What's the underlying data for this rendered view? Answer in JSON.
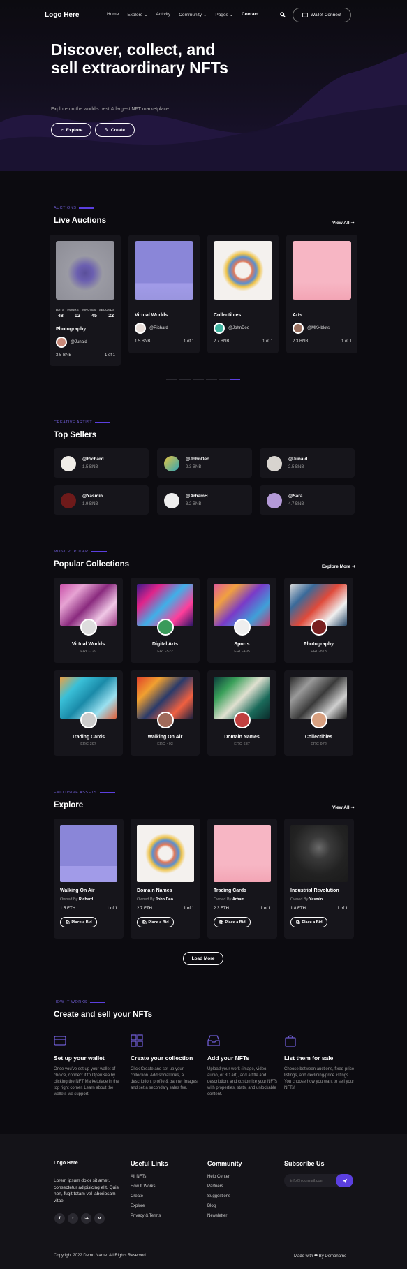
{
  "nav": {
    "logo": "Logo Here",
    "links": [
      "Home",
      "Explore ⌄",
      "Activity",
      "Community ⌄",
      "Pages ⌄",
      "Contact"
    ],
    "search_icon": "search-icon",
    "wallet_label": "Wallet Connect"
  },
  "hero": {
    "title": "Discover, collect, and sell extraordinary NFTs",
    "subtitle": "Explore on the world's best & largest NFT marketplace",
    "explore_label": "Explore",
    "create_label": "Create"
  },
  "auctions": {
    "tag": "AUCTIONS",
    "title": "Live Auctions",
    "view_all": "View All",
    "countdown_labels": [
      "DAYS",
      "HOURS",
      "MINUTES",
      "SECONDS"
    ],
    "countdown_values": [
      "48",
      "02",
      "45",
      "22"
    ],
    "items": [
      {
        "title": "Photography",
        "owner": "@Junaid",
        "price": "3.5 BNB",
        "qty": "1 of 1",
        "color": "#8d8d96"
      },
      {
        "title": "Virtual Worlds",
        "owner": "@Richard",
        "price": "1.5 BNB",
        "qty": "1 of 1",
        "color": "#8a86d8"
      },
      {
        "title": "Collectibles",
        "owner": "@JohnDeo",
        "price": "2.7 BNB",
        "qty": "1 of 1",
        "color": "#f4f1ee"
      },
      {
        "title": "Arts",
        "owner": "@MKHblots",
        "price": "2.3 BNB",
        "qty": "1 of 1",
        "color": "#f7b6c4"
      }
    ]
  },
  "sellers": {
    "tag": "CREATIVE ARTIST",
    "title": "Top Sellers",
    "items": [
      {
        "name": "@Richard",
        "amount": "1.5 BNB"
      },
      {
        "name": "@JohnDeo",
        "amount": "2.3 BNB"
      },
      {
        "name": "@Junaid",
        "amount": "2.5 BNB"
      },
      {
        "name": "@Yasmin",
        "amount": "1.9 BNB"
      },
      {
        "name": "@ArhamH",
        "amount": "3.2 BNB"
      },
      {
        "name": "@Sara",
        "amount": "4.7 BNB"
      }
    ]
  },
  "collections": {
    "tag": "MOST POPULAR",
    "title": "Popular Collections",
    "explore_more": "Explore More",
    "items": [
      {
        "title": "Virtual Worlds",
        "erc": "ERC-729"
      },
      {
        "title": "Digital Arts",
        "erc": "ERC-522"
      },
      {
        "title": "Sports",
        "erc": "ERC-495"
      },
      {
        "title": "Photography",
        "erc": "ERC-873"
      },
      {
        "title": "Trading Cards",
        "erc": "ERC-397"
      },
      {
        "title": "Walking On Air",
        "erc": "ERC-403"
      },
      {
        "title": "Domain Names",
        "erc": "ERC-687"
      },
      {
        "title": "Collectibles",
        "erc": "ERC-972"
      }
    ]
  },
  "explore": {
    "tag": "EXCLUSIVE ASSETS",
    "title": "Explore",
    "view_all": "View All",
    "owned_by": "Owned By",
    "bid_label": "Place a Bid",
    "load_more": "Load More",
    "items": [
      {
        "title": "Walking On Air",
        "owner": "Richard",
        "price": "1.5 ETH",
        "qty": "1 of 1"
      },
      {
        "title": "Domain Names",
        "owner": "John Deo",
        "price": "2.7 ETH",
        "qty": "1 of 1"
      },
      {
        "title": "Trading Cards",
        "owner": "Arham",
        "price": "2.3 ETH",
        "qty": "1 of 1"
      },
      {
        "title": "Industrial Revolution",
        "owner": "Yasmin",
        "price": "1.8 ETH",
        "qty": "1 of 1"
      }
    ]
  },
  "how": {
    "tag": "HOW IT WORKS",
    "title": "Create and sell your NFTs",
    "steps": [
      {
        "title": "Set up your wallet",
        "desc": "Once you've set up your wallet of choice, connect it to OpenSea by clicking the NFT Marketplace in the top right corner. Learn about the wallets we support.",
        "icon": "wallet-icon"
      },
      {
        "title": "Create your collection",
        "desc": "Click Create and set up your collection. Add social links, a description, profile & banner images, and set a secondary sales fee.",
        "icon": "grid-icon"
      },
      {
        "title": "Add your NFTs",
        "desc": "Upload your work (image, video, audio, or 3D art), add a title and description, and customize your NFTs with properties, stats, and unlockable content.",
        "icon": "inbox-icon"
      },
      {
        "title": "List them for sale",
        "desc": "Choose between auctions, fixed-price listings, and declining-price listings. You choose how you want to sell your NFTs!",
        "icon": "bag-icon"
      }
    ]
  },
  "footer": {
    "logo": "Logo Here",
    "about": "Lorem ipsum dolor sit amet, consectetur adipisicing elit. Quis non, fugit totam vel laboriosam vitae.",
    "social": [
      "f",
      "t",
      "G+",
      "v"
    ],
    "useful_title": "Useful Links",
    "useful_links": [
      "All NFTs",
      "How It Works",
      "Create",
      "Explore",
      "Privacy & Terms"
    ],
    "community_title": "Community",
    "community_links": [
      "Help Center",
      "Partners",
      "Suggestions",
      "Blog",
      "Newsletter"
    ],
    "subscribe_title": "Subscribe Us",
    "subscribe_placeholder": "info@yourmail.com",
    "copyright": "Copyright 2022 Demo Name. All Rights Reserved.",
    "made_with": "Made with ❤ By Demoname"
  },
  "colors": {
    "accent": "#5b3fe0",
    "bg": "#0c0b10",
    "card": "#16151b"
  }
}
